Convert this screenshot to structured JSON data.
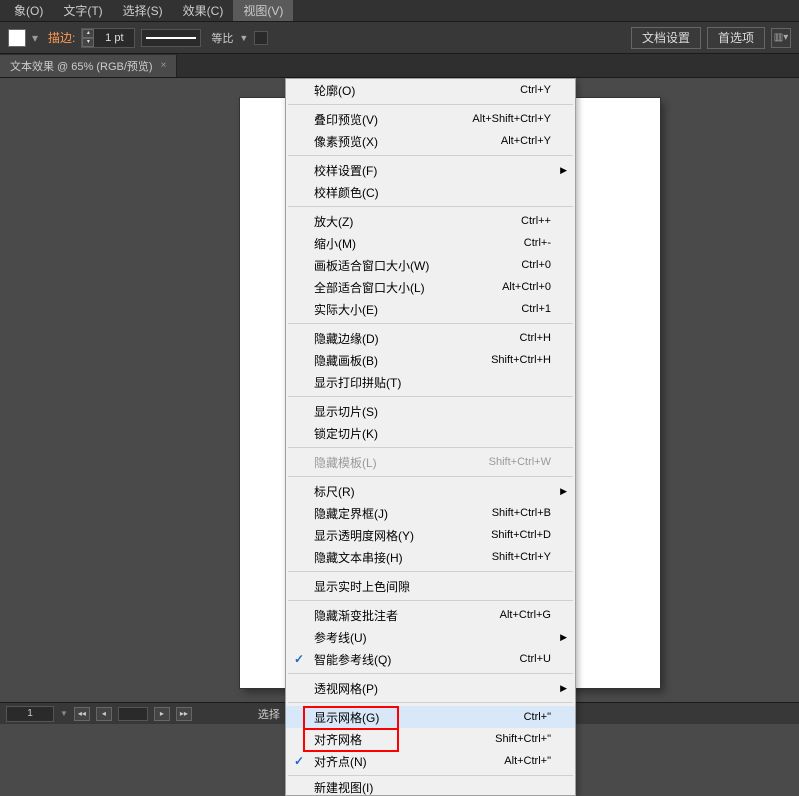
{
  "menubar": {
    "items": [
      {
        "label": "象(O)"
      },
      {
        "label": "文字(T)"
      },
      {
        "label": "选择(S)"
      },
      {
        "label": "效果(C)"
      },
      {
        "label": "视图(V)",
        "active": true
      }
    ]
  },
  "toolbar": {
    "stroke_label": "描边:",
    "stroke_value": "1 pt",
    "ratio_label": "等比",
    "doc_settings": "文档设置",
    "preferences": "首选项"
  },
  "doc_tab": {
    "title": "文本效果 @ 65% (RGB/预览)",
    "close": "×"
  },
  "dropdown": {
    "items": [
      {
        "label": "轮廓(O)",
        "shortcut": "Ctrl+Y"
      },
      {
        "type": "sep"
      },
      {
        "label": "叠印预览(V)",
        "shortcut": "Alt+Shift+Ctrl+Y"
      },
      {
        "label": "像素预览(X)",
        "shortcut": "Alt+Ctrl+Y"
      },
      {
        "type": "sep"
      },
      {
        "label": "校样设置(F)",
        "submenu": true
      },
      {
        "label": "校样颜色(C)"
      },
      {
        "type": "sep"
      },
      {
        "label": "放大(Z)",
        "shortcut": "Ctrl++"
      },
      {
        "label": "缩小(M)",
        "shortcut": "Ctrl+-"
      },
      {
        "label": "画板适合窗口大小(W)",
        "shortcut": "Ctrl+0"
      },
      {
        "label": "全部适合窗口大小(L)",
        "shortcut": "Alt+Ctrl+0"
      },
      {
        "label": "实际大小(E)",
        "shortcut": "Ctrl+1"
      },
      {
        "type": "sep"
      },
      {
        "label": "隐藏边缘(D)",
        "shortcut": "Ctrl+H"
      },
      {
        "label": "隐藏画板(B)",
        "shortcut": "Shift+Ctrl+H"
      },
      {
        "label": "显示打印拼贴(T)"
      },
      {
        "type": "sep"
      },
      {
        "label": "显示切片(S)"
      },
      {
        "label": "锁定切片(K)"
      },
      {
        "type": "sep"
      },
      {
        "label": "隐藏模板(L)",
        "shortcut": "Shift+Ctrl+W",
        "disabled": true
      },
      {
        "type": "sep"
      },
      {
        "label": "标尺(R)",
        "submenu": true
      },
      {
        "label": "隐藏定界框(J)",
        "shortcut": "Shift+Ctrl+B"
      },
      {
        "label": "显示透明度网格(Y)",
        "shortcut": "Shift+Ctrl+D"
      },
      {
        "label": "隐藏文本串接(H)",
        "shortcut": "Shift+Ctrl+Y"
      },
      {
        "type": "sep"
      },
      {
        "label": "显示实时上色间隙"
      },
      {
        "type": "sep"
      },
      {
        "label": "隐藏渐变批注者",
        "shortcut": "Alt+Ctrl+G"
      },
      {
        "label": "参考线(U)",
        "submenu": true
      },
      {
        "label": "智能参考线(Q)",
        "shortcut": "Ctrl+U",
        "checked": true
      },
      {
        "type": "sep"
      },
      {
        "label": "透视网格(P)",
        "submenu": true
      },
      {
        "type": "sep"
      },
      {
        "label": "显示网格(G)",
        "shortcut": "Ctrl+\"",
        "hover": true,
        "redbox": true
      },
      {
        "label": "对齐网格",
        "shortcut": "Shift+Ctrl+\"",
        "redbox": true
      },
      {
        "label": "对齐点(N)",
        "shortcut": "Alt+Ctrl+\"",
        "checked": true
      },
      {
        "type": "sep"
      },
      {
        "label": "新建视图(I)",
        "cut": true
      }
    ]
  },
  "statusbar": {
    "zoom": "1",
    "select_label": "选择"
  }
}
